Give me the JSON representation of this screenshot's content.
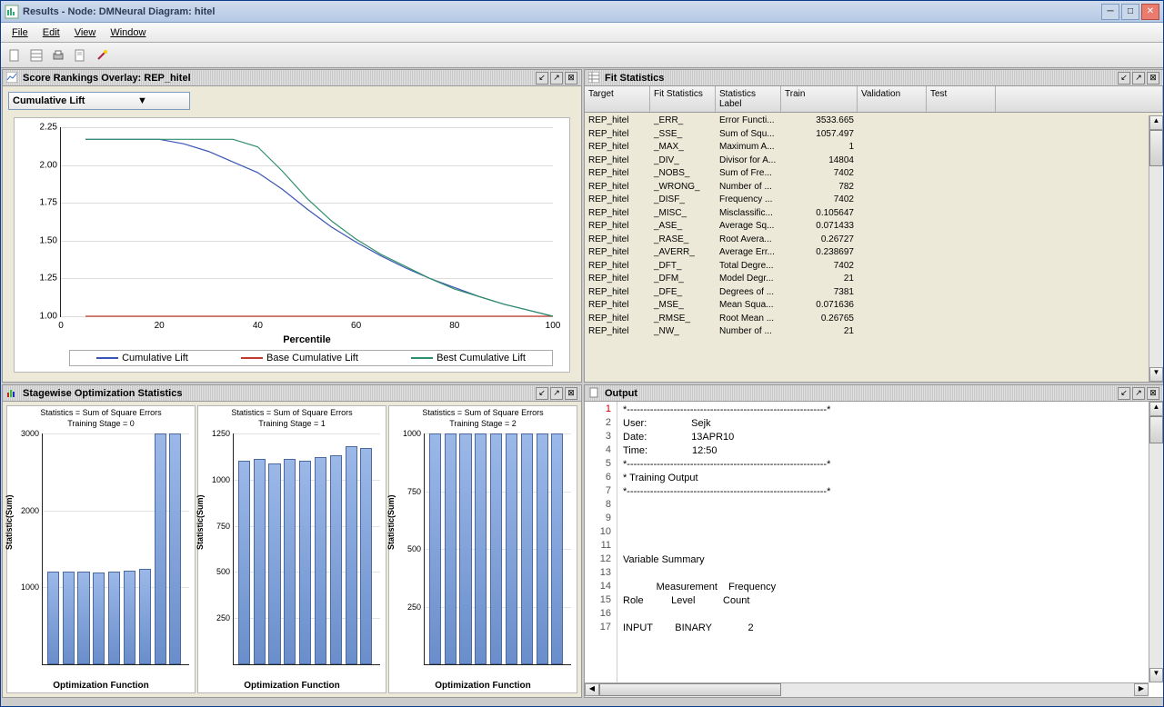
{
  "window": {
    "title": "Results - Node: DMNeural  Diagram: hitel"
  },
  "menu": {
    "file": "File",
    "edit": "Edit",
    "view": "View",
    "window": "Window"
  },
  "panels": {
    "score": {
      "title": "Score Rankings Overlay: REP_hitel",
      "combo": "Cumulative Lift"
    },
    "fit": {
      "title": "Fit Statistics"
    },
    "stage": {
      "title": "Stagewise Optimization Statistics"
    },
    "output": {
      "title": "Output"
    }
  },
  "chart_data": [
    {
      "id": "score_overlay",
      "type": "line",
      "xlabel": "Percentile",
      "ylabel": "",
      "xlim": [
        0,
        100
      ],
      "xticks": [
        0,
        20,
        40,
        60,
        80,
        100
      ],
      "ylim": [
        1.0,
        2.25
      ],
      "yticks": [
        1.0,
        1.25,
        1.5,
        1.75,
        2.0,
        2.25
      ],
      "series": [
        {
          "name": "Cumulative Lift",
          "color": "#3a56b5",
          "x": [
            5,
            10,
            15,
            20,
            25,
            30,
            35,
            40,
            45,
            50,
            55,
            60,
            65,
            70,
            75,
            80,
            85,
            90,
            95,
            100
          ],
          "y": [
            2.17,
            2.17,
            2.17,
            2.17,
            2.14,
            2.09,
            2.02,
            1.95,
            1.84,
            1.71,
            1.59,
            1.49,
            1.4,
            1.32,
            1.25,
            1.19,
            1.13,
            1.08,
            1.04,
            1.0
          ]
        },
        {
          "name": "Base Cumulative Lift",
          "color": "#c23a2d",
          "x": [
            5,
            100
          ],
          "y": [
            1.0,
            1.0
          ]
        },
        {
          "name": "Best Cumulative Lift",
          "color": "#2f8f6a",
          "x": [
            5,
            10,
            15,
            20,
            25,
            30,
            35,
            40,
            45,
            50,
            55,
            60,
            65,
            70,
            75,
            80,
            85,
            90,
            95,
            100
          ],
          "y": [
            2.17,
            2.17,
            2.17,
            2.17,
            2.17,
            2.17,
            2.17,
            2.12,
            1.96,
            1.78,
            1.63,
            1.51,
            1.41,
            1.33,
            1.25,
            1.18,
            1.13,
            1.08,
            1.04,
            1.0
          ]
        }
      ]
    },
    {
      "id": "stagewise",
      "type": "bar",
      "title": "Statistics = Sum of Square Errors",
      "subtitle_prefix": "Training Stage =",
      "xlabel": "Optimization Function",
      "ylabel": "Statistic(Sum)",
      "charts": [
        {
          "stage": 0,
          "ymax": 3000,
          "yticks": [
            1000,
            2000,
            3000
          ],
          "values": [
            1200,
            1210,
            1210,
            1190,
            1210,
            1220,
            1240,
            3120,
            3180
          ]
        },
        {
          "stage": 1,
          "ymax": 1250,
          "yticks": [
            250,
            500,
            750,
            1000,
            1250
          ],
          "values": [
            1100,
            1110,
            1090,
            1110,
            1100,
            1120,
            1130,
            1180,
            1170
          ]
        },
        {
          "stage": 2,
          "ymax": 1000,
          "yticks": [
            250,
            500,
            750,
            1000
          ],
          "values": [
            1080,
            1100,
            1070,
            1090,
            1100,
            1080,
            1110,
            1160,
            1150
          ]
        }
      ]
    }
  ],
  "fit_columns": [
    "Target",
    "Fit Statistics",
    "Statistics Label",
    "Train",
    "Validation",
    "Test"
  ],
  "fit_rows": [
    [
      "REP_hitel",
      "_ERR_",
      "Error Functi...",
      "3533.665",
      "",
      ""
    ],
    [
      "REP_hitel",
      "_SSE_",
      "Sum of Squ...",
      "1057.497",
      "",
      ""
    ],
    [
      "REP_hitel",
      "_MAX_",
      "Maximum A...",
      "1",
      "",
      ""
    ],
    [
      "REP_hitel",
      "_DIV_",
      "Divisor for A...",
      "14804",
      "",
      ""
    ],
    [
      "REP_hitel",
      "_NOBS_",
      "Sum of Fre...",
      "7402",
      "",
      ""
    ],
    [
      "REP_hitel",
      "_WRONG_",
      "Number of ...",
      "782",
      "",
      ""
    ],
    [
      "REP_hitel",
      "_DISF_",
      "Frequency ...",
      "7402",
      "",
      ""
    ],
    [
      "REP_hitel",
      "_MISC_",
      "Misclassific...",
      "0.105647",
      "",
      ""
    ],
    [
      "REP_hitel",
      "_ASE_",
      "Average Sq...",
      "0.071433",
      "",
      ""
    ],
    [
      "REP_hitel",
      "_RASE_",
      "Root Avera...",
      "0.26727",
      "",
      ""
    ],
    [
      "REP_hitel",
      "_AVERR_",
      "Average Err...",
      "0.238697",
      "",
      ""
    ],
    [
      "REP_hitel",
      "_DFT_",
      "Total Degre...",
      "7402",
      "",
      ""
    ],
    [
      "REP_hitel",
      "_DFM_",
      "Model Degr...",
      "21",
      "",
      ""
    ],
    [
      "REP_hitel",
      "_DFE_",
      "Degrees of ...",
      "7381",
      "",
      ""
    ],
    [
      "REP_hitel",
      "_MSE_",
      "Mean Squa...",
      "0.071636",
      "",
      ""
    ],
    [
      "REP_hitel",
      "_RMSE_",
      "Root Mean ...",
      "0.26765",
      "",
      ""
    ],
    [
      "REP_hitel",
      "_NW_",
      "Number of ...",
      "21",
      "",
      ""
    ]
  ],
  "output_lines": [
    "*------------------------------------------------------------*",
    "User:                Sejk",
    "Date:                13APR10",
    "Time:                12:50",
    "*------------------------------------------------------------*",
    "* Training Output",
    "*------------------------------------------------------------*",
    "",
    "",
    "",
    "",
    "Variable Summary",
    "",
    "            Measurement    Frequency",
    "Role          Level          Count",
    "",
    "INPUT        BINARY             2"
  ]
}
